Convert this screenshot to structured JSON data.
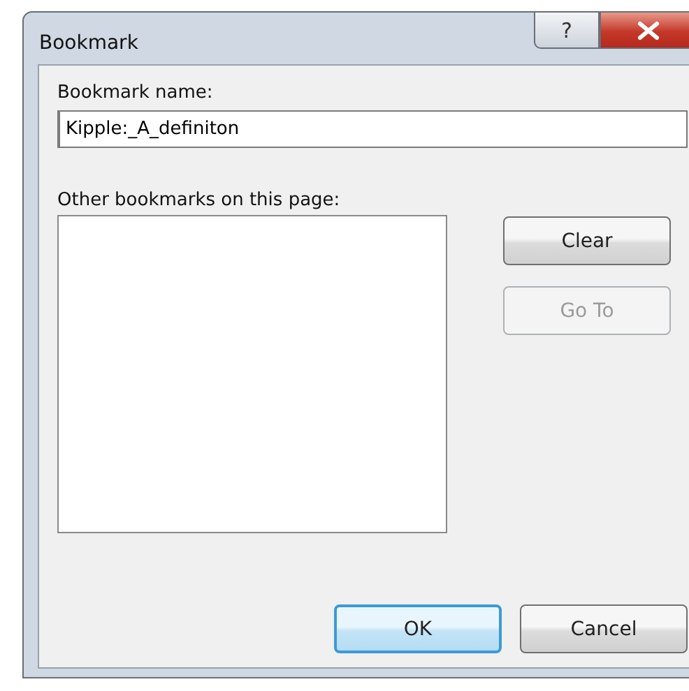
{
  "window": {
    "title": "Bookmark",
    "help_glyph": "?"
  },
  "name_field": {
    "label": "Bookmark name:",
    "value": "Kipple:_A_definiton"
  },
  "bookmarks_list": {
    "label": "Other bookmarks on this page:"
  },
  "side_buttons": [
    {
      "label": "Clear",
      "disabled": false
    },
    {
      "label": "Go To",
      "disabled": true
    }
  ],
  "footer_buttons": [
    {
      "label": "OK",
      "default": true
    },
    {
      "label": "Cancel",
      "default": false
    }
  ]
}
